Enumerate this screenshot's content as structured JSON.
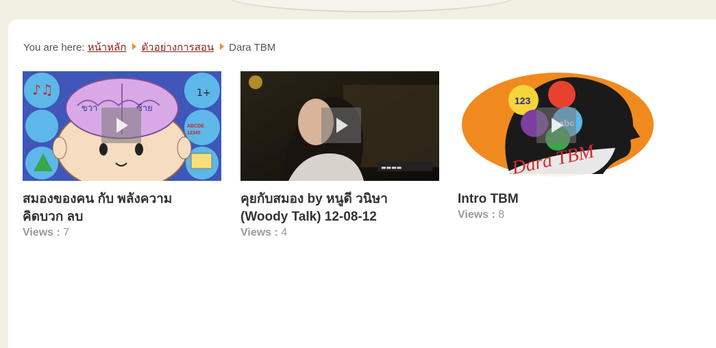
{
  "breadcrumb": {
    "prefix": "You are here:",
    "home": "หน้าหลัก",
    "section": "ตัวอย่างการสอน",
    "current": "Dara TBM"
  },
  "videos": [
    {
      "title_line1": "สมองของคน กับ พลังความ",
      "title_line2": "คิดบวก ลบ",
      "views_label": "Views :",
      "views": "7",
      "thumb_labels": [
        "ขวา",
        "ซ้าย",
        "ABCDE",
        "12345"
      ]
    },
    {
      "title_line1": "คุยกับสมอง by หนูดี วนิษา",
      "title_line2": "(Woody Talk) 12-08-12",
      "views_label": "Views :",
      "views": "4"
    },
    {
      "title_line1": "Intro TBM",
      "title_line2": "",
      "views_label": "Views :",
      "views": "8",
      "thumb_labels": [
        "123",
        "abc",
        "Dara TBM"
      ]
    }
  ]
}
